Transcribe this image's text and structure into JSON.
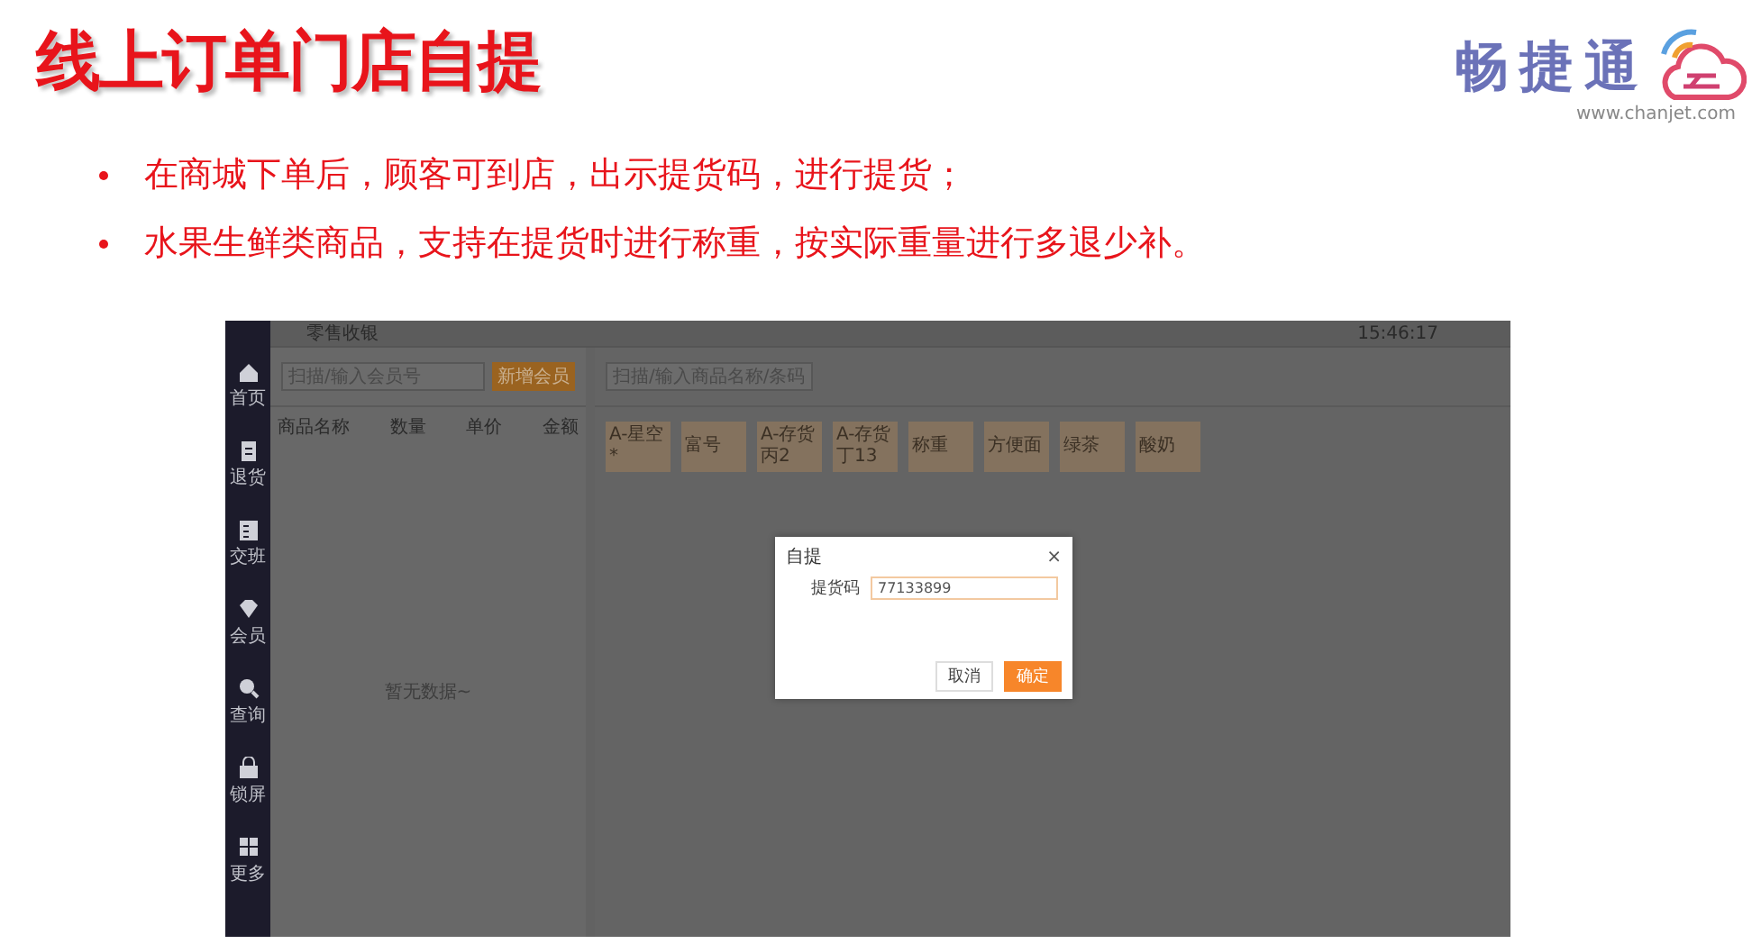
{
  "slide": {
    "title": "线上订单门店自提",
    "logo": {
      "name": "畅捷通",
      "url": "www.chanjet.com"
    },
    "bullets": [
      "在商城下单后，顾客可到店，出示提货码，进行提货；",
      "水果生鲜类商品，支持在提货时进行称重，按实际重量进行多退少补。"
    ]
  },
  "app": {
    "top_bar": {
      "title": "零售收银",
      "time": "15:46:17"
    },
    "sidebar": {
      "items": [
        {
          "label": "首页"
        },
        {
          "label": "退货"
        },
        {
          "label": "交班"
        },
        {
          "label": "会员"
        },
        {
          "label": "查询"
        },
        {
          "label": "锁屏"
        },
        {
          "label": "更多"
        }
      ]
    },
    "cart": {
      "search": {
        "placeholder": "扫描/输入会员号"
      },
      "add_button": "新增会员",
      "columns": [
        "商品名称",
        "数量",
        "单价",
        "金额"
      ],
      "empty_text": "暂无数据~"
    },
    "products": {
      "search": {
        "placeholder": "扫描/输入商品名称/条码"
      },
      "categories": [
        "A-星空*",
        "富号",
        "A-存货丙2",
        "A-存货丁13",
        "称重",
        "方便面",
        "绿茶",
        "酸奶"
      ]
    },
    "dialog": {
      "title": "自提",
      "close": "×",
      "field": {
        "label": "提货码",
        "value": "77133899"
      },
      "buttons": [
        {
          "label": "取消",
          "kind": "secondary"
        },
        {
          "label": "确定",
          "kind": "primary"
        }
      ]
    }
  }
}
